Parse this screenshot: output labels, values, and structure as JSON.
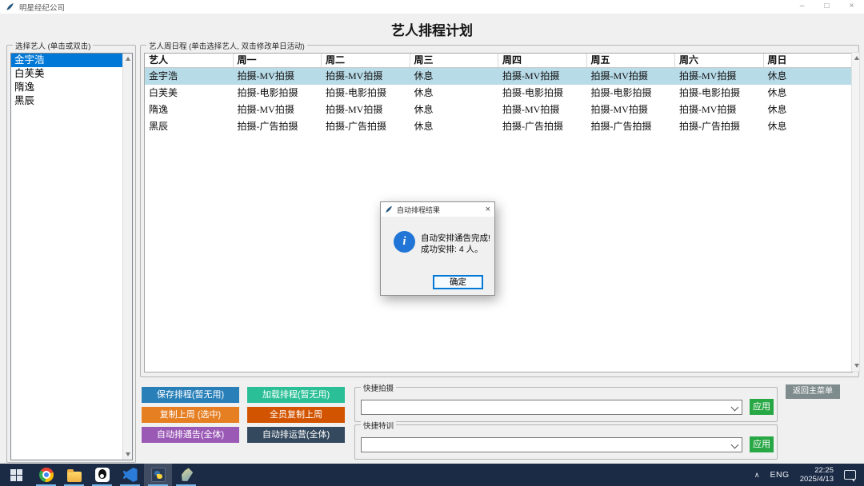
{
  "window": {
    "title": "明星经纪公司",
    "minimize": "–",
    "maximize": "□",
    "close": "×"
  },
  "page_title": "艺人排程计划",
  "artist_panel": {
    "label": "选择艺人 (单击或双击)",
    "items": [
      {
        "name": "金宇浩",
        "selected": true
      },
      {
        "name": "白芙美",
        "selected": false
      },
      {
        "name": "隋逸",
        "selected": false
      },
      {
        "name": "黑辰",
        "selected": false
      }
    ]
  },
  "schedule_panel": {
    "label": "艺人周日程 (单击选择艺人, 双击修改单日活动)",
    "columns": [
      "艺人",
      "周一",
      "周二",
      "周三",
      "周四",
      "周五",
      "周六",
      "周日"
    ],
    "rows": [
      {
        "artist": "金宇浩",
        "selected": true,
        "cells": [
          "拍摄-MV拍摄",
          "拍摄-MV拍摄",
          "休息",
          "拍摄-MV拍摄",
          "拍摄-MV拍摄",
          "拍摄-MV拍摄",
          "休息"
        ]
      },
      {
        "artist": "白芙美",
        "selected": false,
        "cells": [
          "拍摄-电影拍摄",
          "拍摄-电影拍摄",
          "休息",
          "拍摄-电影拍摄",
          "拍摄-电影拍摄",
          "拍摄-电影拍摄",
          "休息"
        ]
      },
      {
        "artist": "隋逸",
        "selected": false,
        "cells": [
          "拍摄-MV拍摄",
          "拍摄-MV拍摄",
          "休息",
          "拍摄-MV拍摄",
          "拍摄-MV拍摄",
          "拍摄-MV拍摄",
          "休息"
        ]
      },
      {
        "artist": "黑辰",
        "selected": false,
        "cells": [
          "拍摄-广告拍摄",
          "拍摄-广告拍摄",
          "休息",
          "拍摄-广告拍摄",
          "拍摄-广告拍摄",
          "拍摄-广告拍摄",
          "休息"
        ]
      }
    ]
  },
  "action_buttons": [
    {
      "name": "save-schedule-button",
      "label": "保存排程(暂无用)",
      "color": "#2980b9"
    },
    {
      "name": "load-schedule-button",
      "label": "加载排程(暂无用)",
      "color": "#2abf96"
    },
    {
      "name": "copy-last-week-button",
      "label": "复制上周 (选中)",
      "color": "#e67e22"
    },
    {
      "name": "copy-last-week-all-button",
      "label": "全员复制上周",
      "color": "#d35400"
    },
    {
      "name": "auto-announce-all-button",
      "label": "自动排通告(全体)",
      "color": "#9b59b6"
    },
    {
      "name": "auto-operations-all-button",
      "label": "自动排运营(全体)",
      "color": "#34495e"
    }
  ],
  "quick_shoot": {
    "label": "快捷拍摄",
    "value": "",
    "apply": "应用"
  },
  "quick_training": {
    "label": "快捷特训",
    "value": "",
    "apply": "应用"
  },
  "back_button": "返回主菜单",
  "dialog": {
    "title": "自动排程结果",
    "close": "×",
    "info_glyph": "i",
    "message_line1": "自动安排通告完成!",
    "message_line2": "成功安排: 4 人。",
    "ok": "确定"
  },
  "taskbar": {
    "apps": [
      {
        "icon": "chrome-icon",
        "active": false,
        "running": true
      },
      {
        "icon": "explorer-icon",
        "active": false,
        "running": true
      },
      {
        "icon": "qq-icon",
        "active": false,
        "running": true
      },
      {
        "icon": "vscode-icon",
        "active": false,
        "running": true
      },
      {
        "icon": "python-icon",
        "active": true,
        "running": true
      },
      {
        "icon": "feather-app-icon",
        "active": false,
        "running": true
      }
    ],
    "tray_chevron": "∧",
    "language": "ENG",
    "time": "22:25",
    "date": "2025/4/13"
  },
  "colors": {
    "selection_blue": "#0078d7",
    "row_highlight": "#b8dbe8",
    "apply_green": "#28a745",
    "back_gray": "#7f8c8d",
    "taskbar_bg": "#1b2a45",
    "info_blue": "#2075d6"
  }
}
